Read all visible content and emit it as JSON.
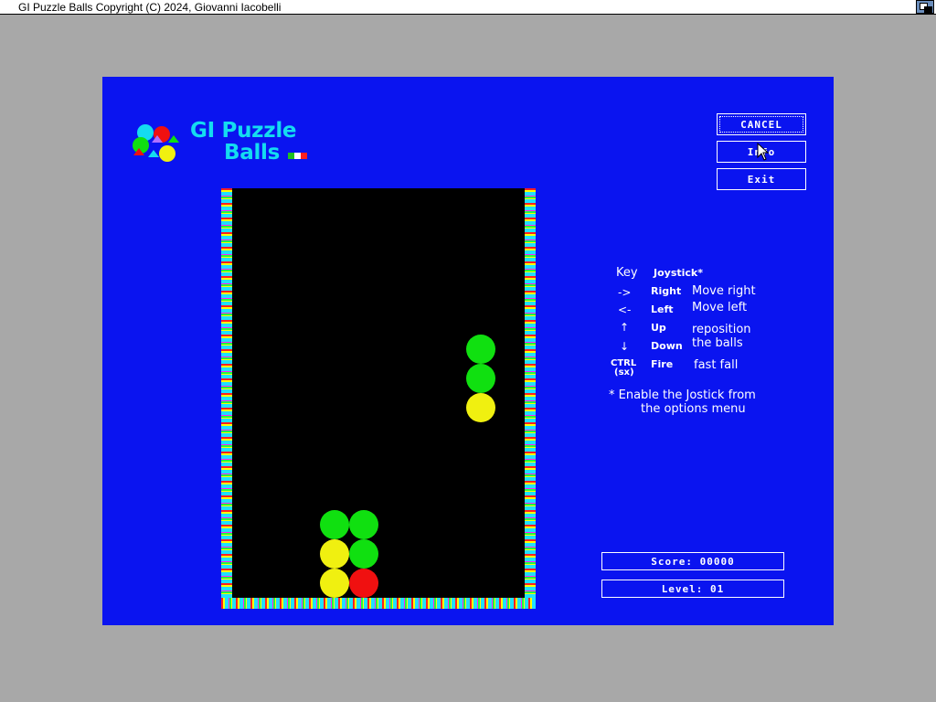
{
  "window": {
    "title": "GI Puzzle Balls Copyright (C) 2024, Giovanni Iacobelli",
    "depth_gadget_icon": "window-depth-icon"
  },
  "logo": {
    "line1": "GI Puzzle",
    "line2": "Balls",
    "flag_colors": [
      "#20c020",
      "#ffffff",
      "#ff2020"
    ]
  },
  "buttons": {
    "cancel": "CANCEL",
    "info": "Info",
    "exit": "Exit"
  },
  "help": {
    "key_header": "Key",
    "joystick_header": "Joystick*",
    "rows": [
      {
        "key": "->",
        "joy": "Right",
        "desc": "Move right"
      },
      {
        "key": "<-",
        "joy": "Left",
        "desc": "Move left"
      },
      {
        "key": "↑",
        "joy": "Up",
        "desc": "reposition"
      },
      {
        "key": "↓",
        "joy": "Down",
        "desc": "the balls"
      },
      {
        "key": "CTRL",
        "key2": "(sx)",
        "joy": "Fire",
        "desc": "fast fall"
      }
    ],
    "note_line1": "* Enable the Jostick from",
    "note_line2": "the options menu"
  },
  "status": {
    "score": "Score: 00000",
    "level": "Level: 01"
  },
  "colors": {
    "screen_bg": "#0a14f0",
    "well_bg": "#000000",
    "green": "#10e010",
    "yellow": "#f0f010",
    "red": "#f01010",
    "logo_text": "#14dcf0"
  },
  "board": {
    "falling_piece": [
      "green",
      "green",
      "yellow"
    ],
    "settled": [
      {
        "col": 3,
        "row_from_bottom": 0,
        "color": "yellow"
      },
      {
        "col": 3,
        "row_from_bottom": 1,
        "color": "yellow"
      },
      {
        "col": 3,
        "row_from_bottom": 2,
        "color": "green"
      },
      {
        "col": 4,
        "row_from_bottom": 0,
        "color": "red"
      },
      {
        "col": 4,
        "row_from_bottom": 1,
        "color": "green"
      },
      {
        "col": 4,
        "row_from_bottom": 2,
        "color": "green"
      }
    ]
  }
}
